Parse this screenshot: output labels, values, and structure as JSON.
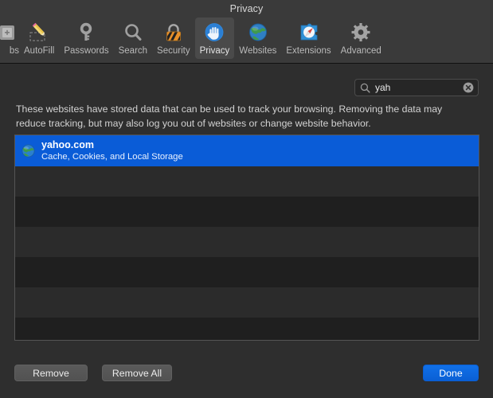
{
  "window": {
    "title": "Privacy"
  },
  "toolbar": {
    "items": [
      {
        "label": "bs",
        "icon": "tabs-icon",
        "selected": false,
        "clipped": true
      },
      {
        "label": "AutoFill",
        "icon": "autofill-pencil-icon",
        "selected": false,
        "clipped": false
      },
      {
        "label": "Passwords",
        "icon": "key-icon",
        "selected": false,
        "clipped": false
      },
      {
        "label": "Search",
        "icon": "magnifier-icon",
        "selected": false,
        "clipped": false
      },
      {
        "label": "Security",
        "icon": "padlock-icon",
        "selected": false,
        "clipped": false
      },
      {
        "label": "Privacy",
        "icon": "hand-icon",
        "selected": true,
        "clipped": false
      },
      {
        "label": "Websites",
        "icon": "globe-icon",
        "selected": false,
        "clipped": false
      },
      {
        "label": "Extensions",
        "icon": "puzzle-compass-icon",
        "selected": false,
        "clipped": false
      },
      {
        "label": "Advanced",
        "icon": "gear-icon",
        "selected": false,
        "clipped": false
      }
    ]
  },
  "search": {
    "value": "yah",
    "placeholder": "Search",
    "icon": "search-icon",
    "clear_icon": "clear-circle-icon"
  },
  "description": "These websites have stored data that can be used to track your browsing. Removing the data may reduce tracking, but may also log you out of websites or change website behavior.",
  "list": {
    "rows": [
      {
        "title": "yahoo.com",
        "subtitle": "Cache, Cookies, and Local Storage",
        "icon": "website-globe-icon",
        "selected": true
      },
      {
        "title": "",
        "subtitle": "",
        "icon": "",
        "selected": false
      },
      {
        "title": "",
        "subtitle": "",
        "icon": "",
        "selected": false
      },
      {
        "title": "",
        "subtitle": "",
        "icon": "",
        "selected": false
      },
      {
        "title": "",
        "subtitle": "",
        "icon": "",
        "selected": false
      },
      {
        "title": "",
        "subtitle": "",
        "icon": "",
        "selected": false
      },
      {
        "title": "",
        "subtitle": "",
        "icon": "",
        "selected": false
      }
    ]
  },
  "footer": {
    "remove_label": "Remove",
    "remove_all_label": "Remove All",
    "done_label": "Done"
  },
  "colors": {
    "selection_blue": "#0a5cd7",
    "done_blue": "#0f6ae4",
    "toolbar_bg": "#3a3a3a",
    "content_bg": "#2e2e2e",
    "row_light": "#2b2b2b",
    "row_dark": "#1f1f1f"
  }
}
